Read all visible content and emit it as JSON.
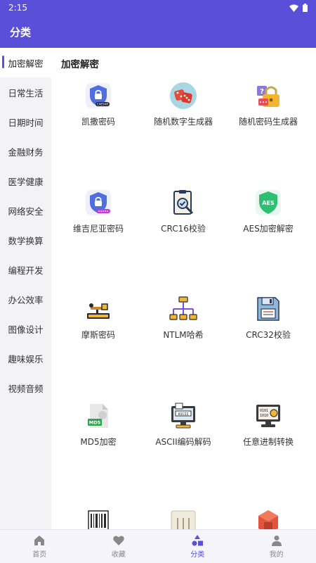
{
  "status_bar": {
    "time": "2:15"
  },
  "app_bar": {
    "title": "分类"
  },
  "sidebar": {
    "items": [
      {
        "label": "加密解密"
      },
      {
        "label": "日常生活"
      },
      {
        "label": "日期时间"
      },
      {
        "label": "金融财务"
      },
      {
        "label": "医学健康"
      },
      {
        "label": "网络安全"
      },
      {
        "label": "数学换算"
      },
      {
        "label": "编程开发"
      },
      {
        "label": "办公效率"
      },
      {
        "label": "图像设计"
      },
      {
        "label": "趣味娱乐"
      },
      {
        "label": "视频音频"
      }
    ]
  },
  "section": {
    "title": "加密解密"
  },
  "tools": [
    {
      "label": "凯撒密码",
      "icon": "caesar-shield-icon"
    },
    {
      "label": "随机数字生成器",
      "icon": "dice-icon"
    },
    {
      "label": "随机密码生成器",
      "icon": "padlock-icon"
    },
    {
      "label": "维吉尼亚密码",
      "icon": "vigenere-shield-icon"
    },
    {
      "label": "CRC16校验",
      "icon": "checklist-icon"
    },
    {
      "label": "AES加密解密",
      "icon": "aes-shield-icon"
    },
    {
      "label": "摩斯密码",
      "icon": "telegraph-key-icon"
    },
    {
      "label": "NTLM哈希",
      "icon": "network-icon"
    },
    {
      "label": "CRC32校验",
      "icon": "floppy-disk-icon"
    },
    {
      "label": "MD5加密",
      "icon": "md5-file-icon"
    },
    {
      "label": "ASCII编码解码",
      "icon": "ascii-monitor-icon"
    },
    {
      "label": "任意进制转换",
      "icon": "binary-convert-icon"
    },
    {
      "label": "",
      "icon": "barcode-icon"
    },
    {
      "label": "",
      "icon": "scroll-icon"
    },
    {
      "label": "",
      "icon": "red-block-icon"
    }
  ],
  "bottom_nav": {
    "items": [
      {
        "label": "首页",
        "icon": "home-icon"
      },
      {
        "label": "收藏",
        "icon": "heart-icon"
      },
      {
        "label": "分类",
        "icon": "category-icon"
      },
      {
        "label": "我的",
        "icon": "person-icon"
      }
    ],
    "active": "分类"
  },
  "colors": {
    "primary": "#5a4fd8",
    "sidebar_bg": "#f3f3f6",
    "nav_bg": "#f6f4fb"
  }
}
